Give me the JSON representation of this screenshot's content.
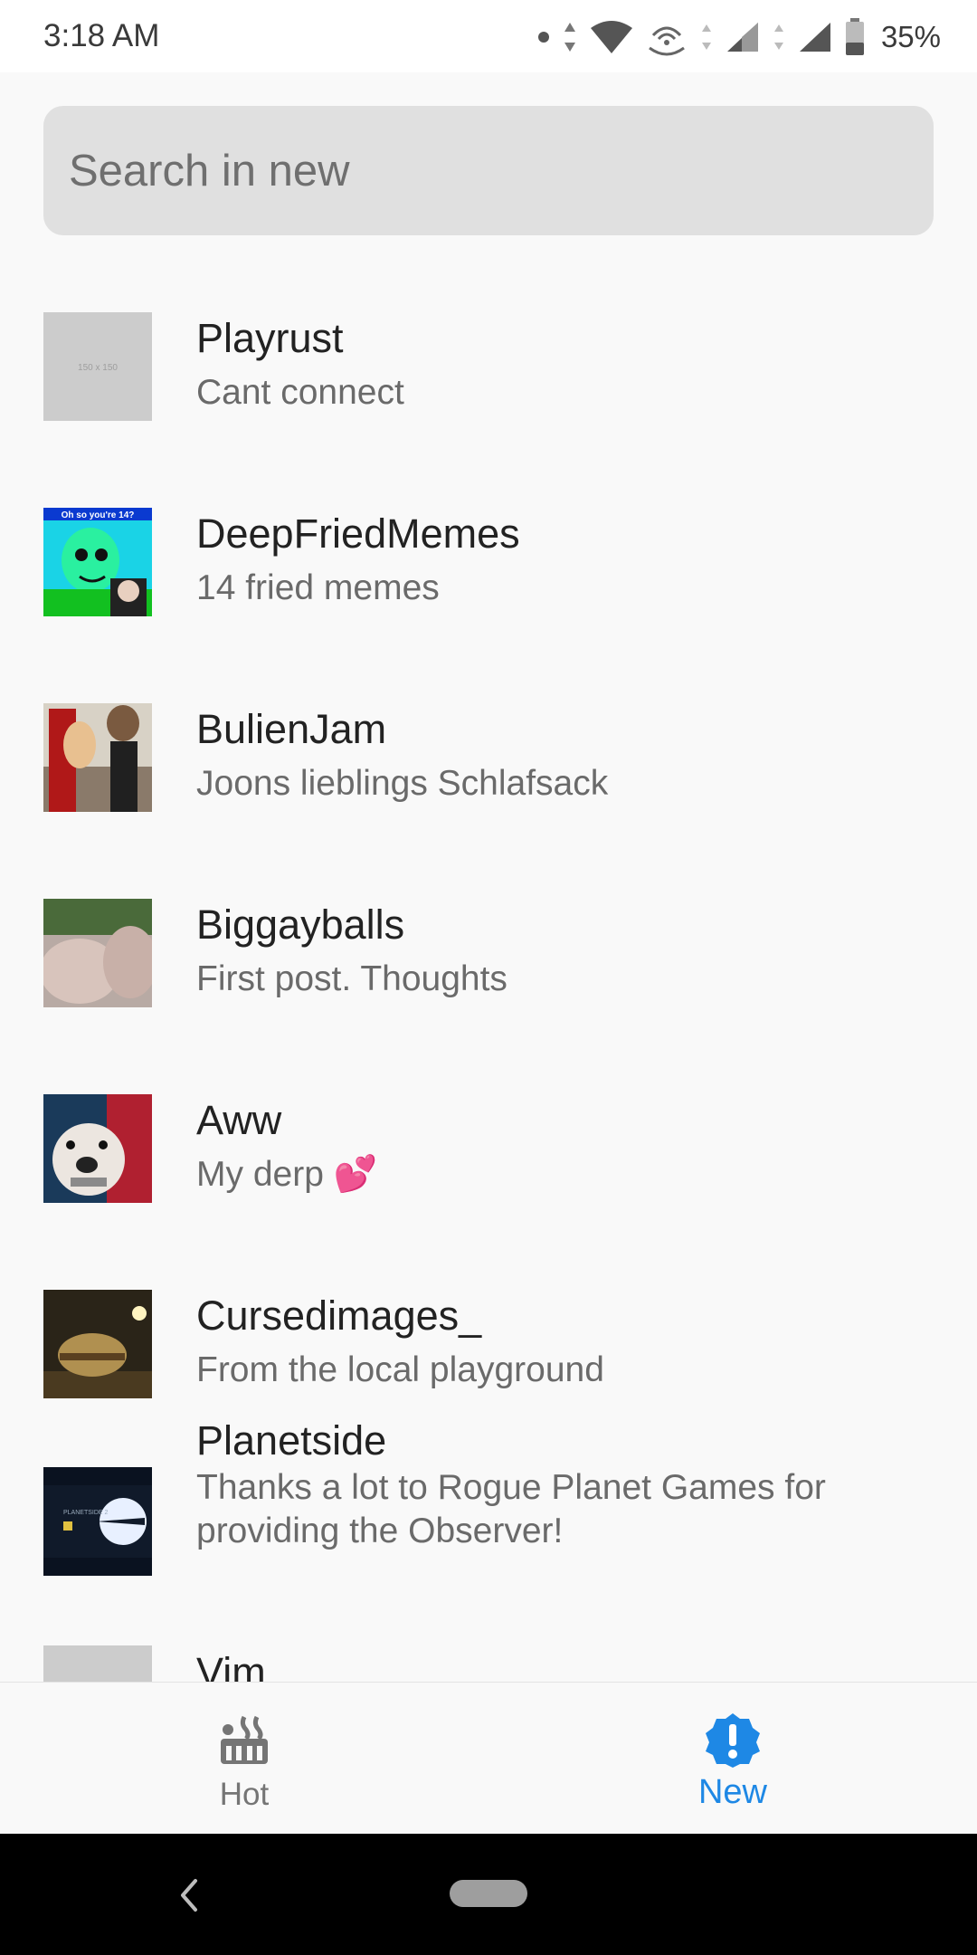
{
  "status_bar": {
    "time": "3:18 AM",
    "battery": "35%",
    "icons": [
      "dot-icon",
      "data-arrows-icon",
      "wifi-icon",
      "hotspot-icon",
      "signal-icon",
      "signal-icon",
      "battery-icon"
    ]
  },
  "search": {
    "placeholder": "Search in new",
    "value": ""
  },
  "list": [
    {
      "title": "Playrust",
      "subtitle": "Cant connect",
      "thumb": "placeholder-150x150",
      "thumb_text": "150 x 150"
    },
    {
      "title": "DeepFriedMemes",
      "subtitle": "14 fried memes",
      "thumb": "meme",
      "thumb_text": "Oh so you're 14?"
    },
    {
      "title": "BulienJam",
      "subtitle": "Joons lieblings Schlafsack",
      "thumb": "photo"
    },
    {
      "title": "Biggayballs",
      "subtitle": "First post. Thoughts",
      "thumb": "photo"
    },
    {
      "title": "Aww",
      "subtitle": "My derp 💕",
      "thumb": "dog-photo"
    },
    {
      "title": "Cursedimages_",
      "subtitle": "From the local playground",
      "thumb": "night-photo"
    },
    {
      "title": "Planetside",
      "subtitle": "Thanks a lot to Rogue Planet Games for providing the Observer!",
      "thumb": "game-banner",
      "thumb_text": "PLANETSIDE 2"
    },
    {
      "title": "Vim",
      "subtitle": "",
      "thumb": "placeholder"
    }
  ],
  "bottom_nav": {
    "hot_label": "Hot",
    "new_label": "New",
    "active": "new"
  },
  "colors": {
    "accent": "#1e88e5",
    "background": "#f9f9f9",
    "search_bg": "#e0e0e0"
  }
}
